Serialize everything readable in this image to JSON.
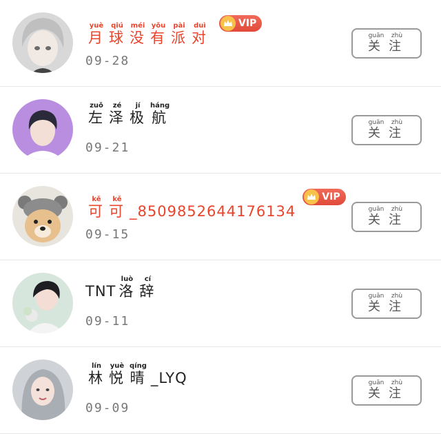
{
  "follow_label": {
    "chars": [
      "关",
      "注"
    ],
    "pinyin": [
      "guān",
      "zhù"
    ]
  },
  "accent_color": "#e9442c",
  "vip_label": "VIP",
  "rows": [
    {
      "vip": true,
      "name_chars": [
        "月",
        "球",
        "没",
        "有",
        "派",
        "对"
      ],
      "name_pinyin": [
        "yuè",
        "qiú",
        "méi",
        "yǒu",
        "pài",
        "duì"
      ],
      "name_prefix": "",
      "name_suffix": "",
      "date": "09-28",
      "avatar": "silver-haired-character-avatar"
    },
    {
      "vip": false,
      "name_chars": [
        "左",
        "泽",
        "极",
        "航"
      ],
      "name_pinyin": [
        "zuǒ",
        "zé",
        "jí",
        "háng"
      ],
      "name_prefix": "",
      "name_suffix": "",
      "date": "09-21",
      "avatar": "boy-purple-background-avatar"
    },
    {
      "vip": true,
      "name_chars": [
        "可",
        "可"
      ],
      "name_pinyin": [
        "kě",
        "kě"
      ],
      "name_prefix": "",
      "name_suffix": "_8509852644176134",
      "date": "09-15",
      "avatar": "dog-with-bear-hat-avatar"
    },
    {
      "vip": false,
      "name_chars": [
        "洛",
        "辞"
      ],
      "name_pinyin": [
        "luò",
        "cí"
      ],
      "name_prefix": "TNT",
      "name_suffix": "",
      "date": "09-11",
      "avatar": "person-with-flowers-avatar"
    },
    {
      "vip": false,
      "name_chars": [
        "林",
        "悦",
        "晴"
      ],
      "name_pinyin": [
        "lín",
        "yuè",
        "qíng"
      ],
      "name_prefix": "",
      "name_suffix": "_LYQ",
      "date": "09-09",
      "avatar": "girl-silver-hair-avatar"
    }
  ]
}
